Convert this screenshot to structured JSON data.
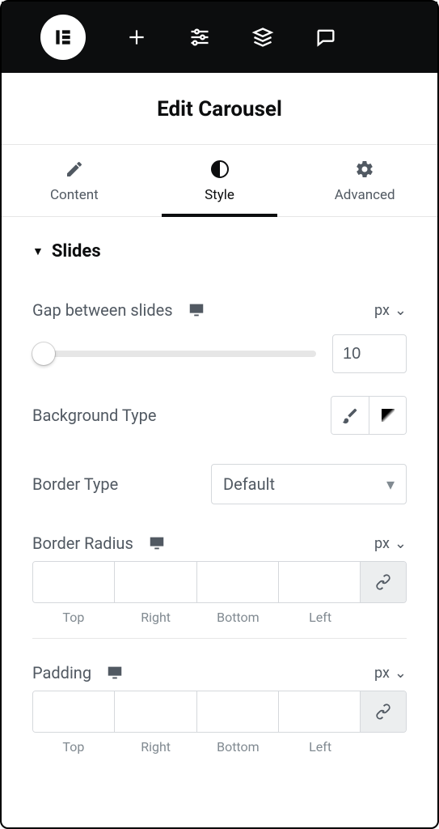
{
  "title": "Edit Carousel",
  "tabs": {
    "content": "Content",
    "style": "Style",
    "advanced": "Advanced"
  },
  "section": {
    "slides_title": "Slides"
  },
  "controls": {
    "gap_label": "Gap between slides",
    "gap_unit": "px",
    "gap_value": "10",
    "bg_type_label": "Background Type",
    "border_type_label": "Border Type",
    "border_type_value": "Default",
    "border_radius_label": "Border Radius",
    "border_radius_unit": "px",
    "padding_label": "Padding",
    "padding_unit": "px"
  },
  "sides": {
    "top": "Top",
    "right": "Right",
    "bottom": "Bottom",
    "left": "Left"
  }
}
